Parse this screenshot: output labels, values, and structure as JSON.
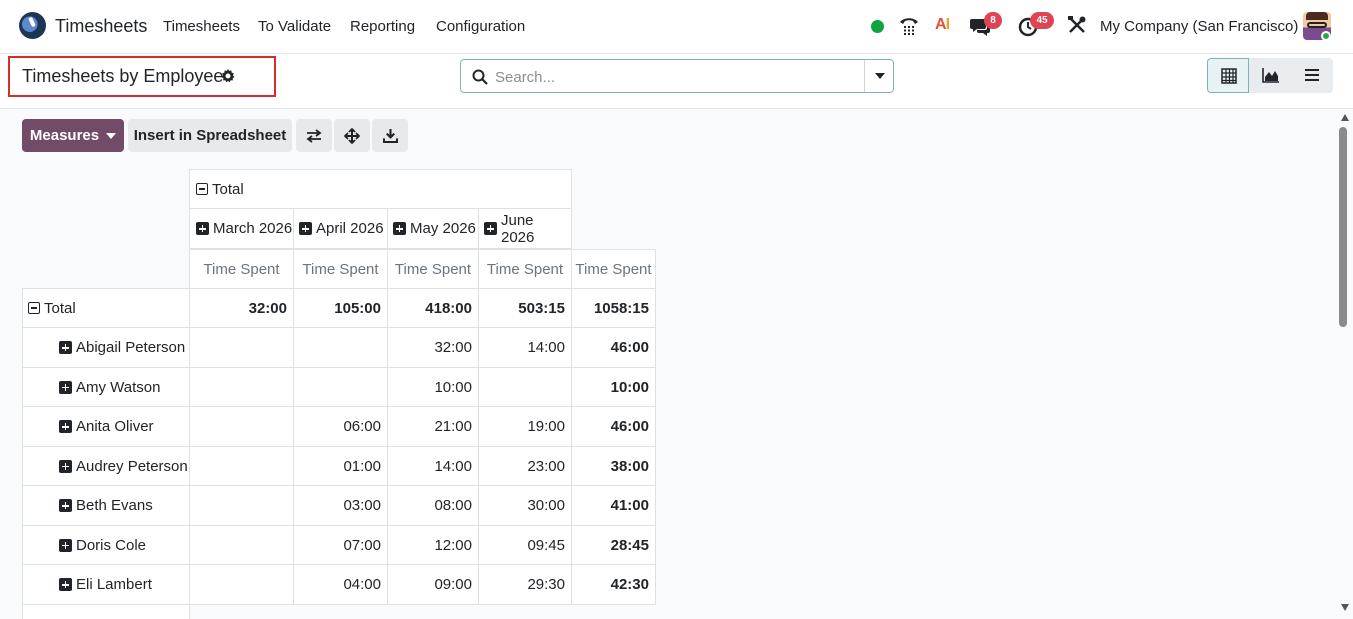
{
  "navbar": {
    "app_name": "Timesheets",
    "menu": [
      "Timesheets",
      "To Validate",
      "Reporting",
      "Configuration"
    ],
    "messages_count": "8",
    "activities_count": "45",
    "company": "My Company (San Francisco)",
    "ai_label_a": "A",
    "ai_label_i": "I"
  },
  "control": {
    "title": "Timesheets by Employee",
    "search_placeholder": "Search..."
  },
  "buttons": {
    "measures": "Measures",
    "insert_spreadsheet": "Insert in Spreadsheet"
  },
  "pivot": {
    "col_group_header": "Total",
    "columns": [
      "March 2026",
      "April 2026",
      "May 2026",
      "June 2026"
    ],
    "measure": "Time Spent",
    "total_row": {
      "label": "Total",
      "values": [
        "32:00",
        "105:00",
        "418:00",
        "503:15",
        "1058:15"
      ]
    },
    "rows": [
      {
        "label": "Abigail Peterson",
        "values": [
          "",
          "",
          "32:00",
          "14:00",
          "46:00"
        ]
      },
      {
        "label": "Amy Watson",
        "values": [
          "",
          "",
          "10:00",
          "",
          "10:00"
        ]
      },
      {
        "label": "Anita Oliver",
        "values": [
          "",
          "06:00",
          "21:00",
          "19:00",
          "46:00"
        ]
      },
      {
        "label": "Audrey Peterson",
        "values": [
          "",
          "01:00",
          "14:00",
          "23:00",
          "38:00"
        ]
      },
      {
        "label": "Beth Evans",
        "values": [
          "",
          "03:00",
          "08:00",
          "30:00",
          "41:00"
        ]
      },
      {
        "label": "Doris Cole",
        "values": [
          "",
          "07:00",
          "12:00",
          "09:45",
          "28:45"
        ]
      },
      {
        "label": "Eli Lambert",
        "values": [
          "",
          "04:00",
          "09:00",
          "29:30",
          "42:30"
        ]
      }
    ]
  },
  "colors": {
    "primary": "#714b67",
    "accent": "#7fb4b6",
    "highlight_border": "#d32f2f",
    "status_online": "#11a33d",
    "badge": "#e04353"
  },
  "icons": [
    "app-logo-icon",
    "phone-icon",
    "chat-icon",
    "clock-icon",
    "tools-icon",
    "gear-icon",
    "search-icon",
    "pivot-view-icon",
    "graph-view-icon",
    "list-view-icon",
    "flip-axis-icon",
    "expand-all-icon",
    "download-icon"
  ]
}
